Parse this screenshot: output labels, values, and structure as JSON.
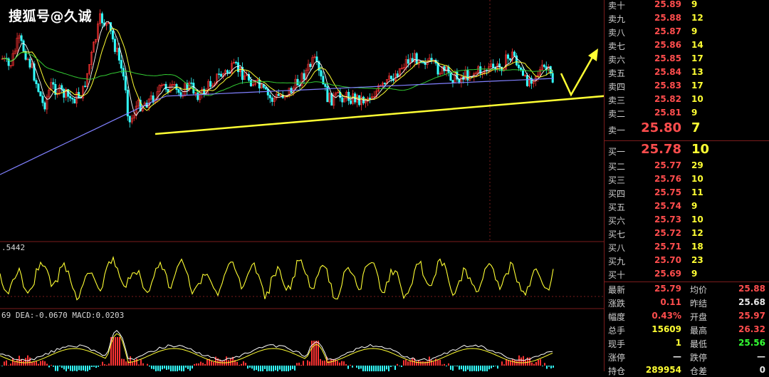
{
  "watermark": "搜狐号@久诚",
  "indicators": {
    "osc_label": ".5442",
    "macd_label": "69 DEA:-0.0670 MACD:0.0203"
  },
  "colors": {
    "up": "#ff3333",
    "down": "#33ffff",
    "ma_white": "#ffffff",
    "ma_yellow": "#ffff33",
    "ma_green": "#33cc33",
    "ma_blue": "#8080ff",
    "annotation": "#ffff33",
    "grid": "#7a1c1c"
  },
  "asks": [
    {
      "label": "卖十",
      "price": "25.89",
      "vol": "9"
    },
    {
      "label": "卖九",
      "price": "25.88",
      "vol": "12"
    },
    {
      "label": "卖八",
      "price": "25.87",
      "vol": "9"
    },
    {
      "label": "卖七",
      "price": "25.86",
      "vol": "14"
    },
    {
      "label": "卖六",
      "price": "25.85",
      "vol": "17"
    },
    {
      "label": "卖五",
      "price": "25.84",
      "vol": "13"
    },
    {
      "label": "卖四",
      "price": "25.83",
      "vol": "17"
    },
    {
      "label": "卖三",
      "price": "25.82",
      "vol": "10"
    },
    {
      "label": "卖二",
      "price": "25.81",
      "vol": "9"
    },
    {
      "label": "卖一",
      "price": "25.80",
      "vol": "7"
    }
  ],
  "bids": [
    {
      "label": "买一",
      "price": "25.78",
      "vol": "10"
    },
    {
      "label": "买二",
      "price": "25.77",
      "vol": "29"
    },
    {
      "label": "买三",
      "price": "25.76",
      "vol": "10"
    },
    {
      "label": "买四",
      "price": "25.75",
      "vol": "11"
    },
    {
      "label": "买五",
      "price": "25.74",
      "vol": "9"
    },
    {
      "label": "买六",
      "price": "25.73",
      "vol": "10"
    },
    {
      "label": "买七",
      "price": "25.72",
      "vol": "12"
    },
    {
      "label": "买八",
      "price": "25.71",
      "vol": "18"
    },
    {
      "label": "买九",
      "price": "25.70",
      "vol": "23"
    },
    {
      "label": "买十",
      "price": "25.69",
      "vol": "9"
    }
  ],
  "stats": [
    {
      "l1": "最新",
      "v1": "25.79",
      "c1": "red",
      "l2": "均价",
      "v2": "25.88",
      "c2": "red"
    },
    {
      "l1": "涨跌",
      "v1": "0.11",
      "c1": "red",
      "l2": "昨结",
      "v2": "25.68",
      "c2": "wht"
    },
    {
      "l1": "幅度",
      "v1": "0.43%",
      "c1": "red",
      "l2": "开盘",
      "v2": "25.97",
      "c2": "red"
    },
    {
      "l1": "总手",
      "v1": "15609",
      "c1": "yel",
      "l2": "最高",
      "v2": "26.32",
      "c2": "red"
    },
    {
      "l1": "现手",
      "v1": "1",
      "c1": "yel",
      "l2": "最低",
      "v2": "25.56",
      "c2": "grn"
    },
    {
      "l1": "涨停",
      "v1": "—",
      "c1": "wht",
      "l2": "跌停",
      "v2": "—",
      "c2": "wht"
    },
    {
      "l1": "持仓",
      "v1": "289954",
      "c1": "yel",
      "l2": "仓差",
      "v2": "0",
      "c2": "wht"
    }
  ]
}
